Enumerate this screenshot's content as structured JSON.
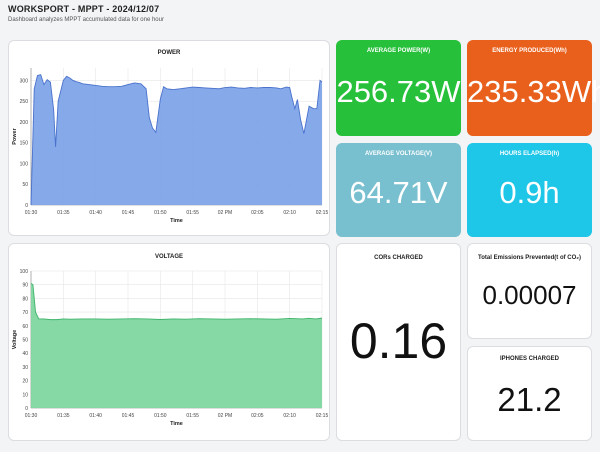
{
  "header": {
    "title": "WORKSPORT - MPPT - 2024/12/07",
    "subtitle": "Dashboard analyzes MPPT accumulated data for one hour"
  },
  "power_chart": {
    "title": "POWER",
    "xlabel": "Time",
    "ylabel": "Power",
    "color": "#7ea4e8",
    "line_color": "#4a72cc"
  },
  "voltage_chart": {
    "title": "VOLTAGE",
    "xlabel": "Time",
    "ylabel": "Voltage",
    "color": "#7fd6a0",
    "line_color": "#3fb36a"
  },
  "chart_data": [
    {
      "type": "area",
      "title": "POWER",
      "xlabel": "Time",
      "ylabel": "Power",
      "xlim": [
        0,
        45
      ],
      "ylim": [
        0,
        330
      ],
      "x_ticks": [
        "01:30",
        "01:35",
        "01:40",
        "01:45",
        "01:50",
        "01:55",
        "02 PM",
        "02:05",
        "02:10",
        "02:15"
      ],
      "x_tick_values": [
        0,
        5,
        10,
        15,
        20,
        25,
        30,
        35,
        40,
        45
      ],
      "y_ticks": [
        0,
        50,
        100,
        150,
        200,
        250,
        300
      ],
      "grid": true,
      "series": [
        {
          "x": [
            0,
            0.5,
            1,
            1.5,
            2,
            2.5,
            3,
            3.5,
            3.8,
            4.2,
            5,
            5.5,
            6,
            6.5,
            7,
            7.5,
            8,
            9,
            10,
            11,
            12,
            13,
            14,
            15,
            16,
            17,
            17.8,
            18.3,
            18.8,
            19.3,
            20,
            20.5,
            21,
            22,
            23,
            24,
            25,
            26,
            27,
            28,
            29,
            30,
            31,
            32,
            33,
            34,
            35,
            36,
            37,
            38,
            38.6,
            39.5,
            40,
            40.3,
            40.8,
            41.2,
            41.7,
            42.2,
            43,
            43.7,
            44.2,
            44.7,
            45
          ],
          "y": [
            0,
            280,
            312,
            314,
            290,
            302,
            296,
            230,
            140,
            250,
            300,
            310,
            306,
            300,
            297,
            295,
            292,
            290,
            288,
            286,
            285,
            285,
            286,
            290,
            294,
            292,
            280,
            210,
            185,
            175,
            255,
            285,
            280,
            278,
            280,
            282,
            284,
            283,
            282,
            281,
            280,
            283,
            284,
            282,
            281,
            283,
            282,
            283,
            283,
            282,
            280,
            284,
            283,
            262,
            232,
            254,
            205,
            172,
            238,
            232,
            232,
            300,
            296
          ]
        }
      ]
    },
    {
      "type": "area",
      "title": "VOLTAGE",
      "xlabel": "Time",
      "ylabel": "Voltage",
      "xlim": [
        0,
        45
      ],
      "ylim": [
        0,
        100
      ],
      "x_ticks": [
        "01:30",
        "01:35",
        "01:40",
        "01:45",
        "01:50",
        "01:55",
        "02 PM",
        "02:05",
        "02:10",
        "02:15"
      ],
      "x_tick_values": [
        0,
        5,
        10,
        15,
        20,
        25,
        30,
        35,
        40,
        45
      ],
      "y_ticks": [
        0,
        10,
        20,
        30,
        40,
        50,
        60,
        70,
        80,
        90,
        100
      ],
      "grid": true,
      "series": [
        {
          "x": [
            0,
            0.3,
            0.7,
            1.2,
            2,
            3,
            4,
            5,
            6,
            8,
            10,
            12,
            14,
            16,
            18,
            20,
            22,
            24,
            26,
            28,
            30,
            32,
            34,
            36,
            38,
            40,
            42,
            43,
            44,
            45
          ],
          "y": [
            91,
            90,
            70,
            65,
            65,
            64.5,
            64.5,
            65,
            64.8,
            65,
            65,
            64.8,
            65,
            65.2,
            65,
            64.6,
            65,
            64.8,
            65.2,
            65,
            64.8,
            65,
            65.2,
            65,
            64.8,
            65.4,
            65,
            65.5,
            65,
            65.6
          ]
        }
      ]
    }
  ],
  "stats": {
    "avg_power": {
      "label": "AVERAGE POWER(W)",
      "value": "256.73W",
      "color": "#27c03a"
    },
    "energy": {
      "label": "ENERGY PRODUCED(Wh)",
      "value": "235.33Wh",
      "color": "#e8601c"
    },
    "avg_voltage": {
      "label": "AVERAGE VOLTAGE(V)",
      "value": "64.71V",
      "color": "#78bfcf"
    },
    "hours": {
      "label": "HOURS  ELAPSED(h)",
      "value": "0.9h",
      "color": "#1ec6e8"
    },
    "cor": {
      "label": "CORs CHARGED",
      "value": "0.16"
    },
    "emissions": {
      "label": "Total Emissions Prevented(t of CO₂)",
      "value": "0.00007"
    },
    "iphones": {
      "label": "IPHONES CHARGED",
      "value": "21.2"
    }
  }
}
